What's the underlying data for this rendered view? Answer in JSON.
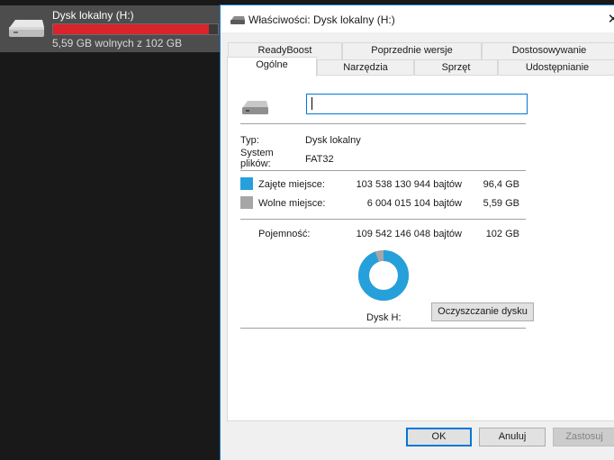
{
  "explorer": {
    "drive_name": "Dysk lokalny (H:)",
    "free_text": "5,59 GB wolnych z 102 GB",
    "used_fraction": 0.946,
    "bar_color": "#d9242c"
  },
  "dialog": {
    "title": "Właściwości: Dysk lokalny (H:)",
    "close_glyph": "✕",
    "tabs_back": [
      "ReadyBoost",
      "Poprzednie wersje",
      "Dostosowywanie"
    ],
    "tabs_front": [
      "Ogólne",
      "Narzędzia",
      "Sprzęt",
      "Udostępnianie"
    ],
    "active_tab": "Ogólne",
    "general": {
      "name_value": "",
      "type_label": "Typ:",
      "type_value": "Dysk lokalny",
      "fs_label": "System\nplików:",
      "fs_value": "FAT32",
      "used_label": "Zajęte miejsce:",
      "used_bytes": "103 538 130 944 bajtów",
      "used_gb": "96,4 GB",
      "free_label": "Wolne miejsce:",
      "free_bytes": "6 004 015 104 bajtów",
      "free_gb": "5,59 GB",
      "capacity_label": "Pojemność:",
      "capacity_bytes": "109 542 146 048 bajtów",
      "capacity_gb": "102 GB",
      "drive_label": "Dysk H:",
      "cleanup_button": "Oczyszczanie dysku",
      "used_color": "#26a0da",
      "free_color": "#a6a6a6",
      "used_fraction": 0.945
    },
    "buttons": {
      "ok": "OK",
      "cancel": "Anuluj",
      "apply": "Zastosuj"
    }
  }
}
